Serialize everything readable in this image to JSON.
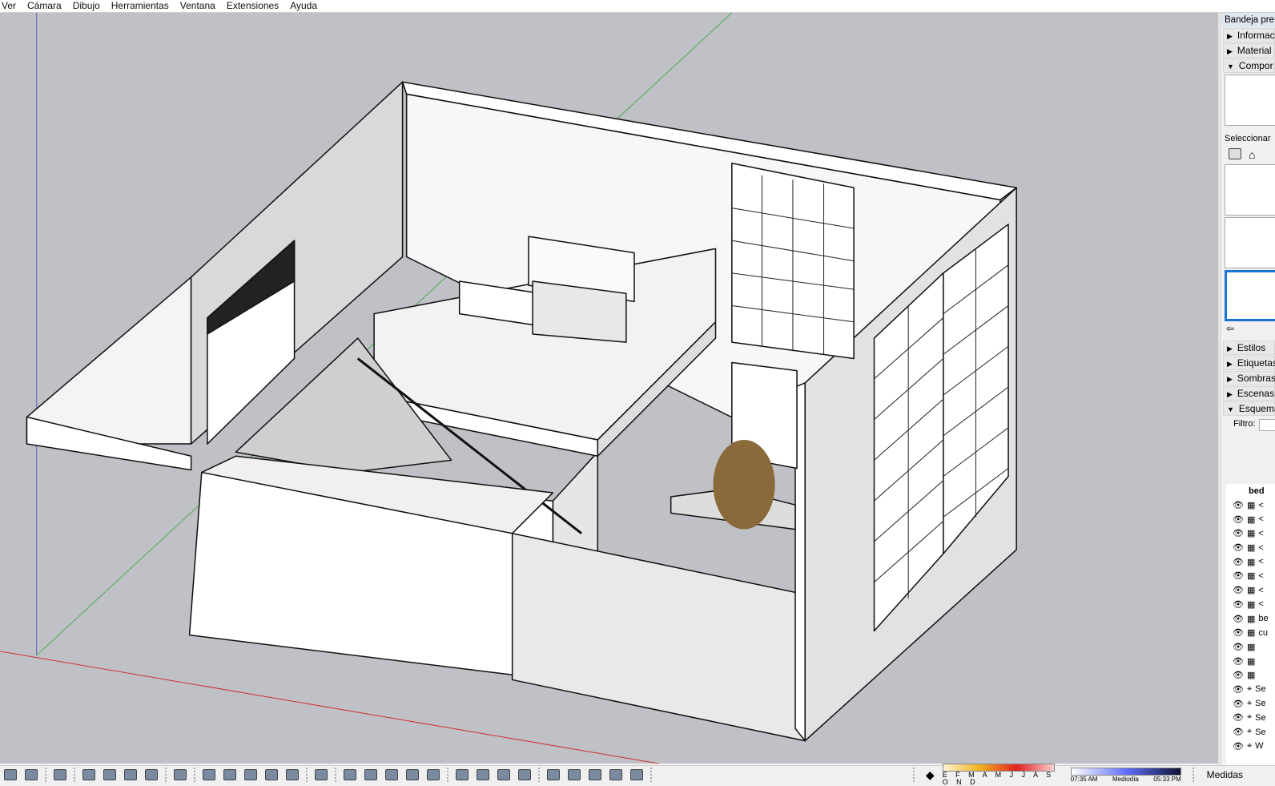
{
  "menu": [
    "Ver",
    "Cámara",
    "Dibujo",
    "Herramientas",
    "Ventana",
    "Extensiones",
    "Ayuda"
  ],
  "tray": {
    "title": "Bandeja pre",
    "top_sections": [
      {
        "label": "Informac",
        "open": false
      },
      {
        "label": "Material",
        "open": false
      },
      {
        "label": "Compor",
        "open": true
      }
    ],
    "select_label": "Seleccionar",
    "bottom_sections": [
      {
        "label": "Estilos"
      },
      {
        "label": "Etiquetas"
      },
      {
        "label": "Sombras"
      },
      {
        "label": "Escenas"
      },
      {
        "label": "Esquema"
      }
    ],
    "filter_label": "Filtro:",
    "filter_value": "",
    "outliner_root": "bed",
    "outliner_rows": [
      "<",
      "<",
      "<",
      "<",
      "<",
      "<",
      "<",
      "<",
      "be",
      "cu",
      "",
      "",
      "",
      "Se",
      "Se",
      "Se",
      "Se",
      "W"
    ]
  },
  "status": {
    "months": "E F M A M J J A S O N D",
    "time_start": "07:35 AM",
    "time_mid": "Mediodía",
    "time_end": "05:33 PM",
    "measure_label": "Medidas",
    "month_position": 0.86,
    "time_position": 0.61
  }
}
